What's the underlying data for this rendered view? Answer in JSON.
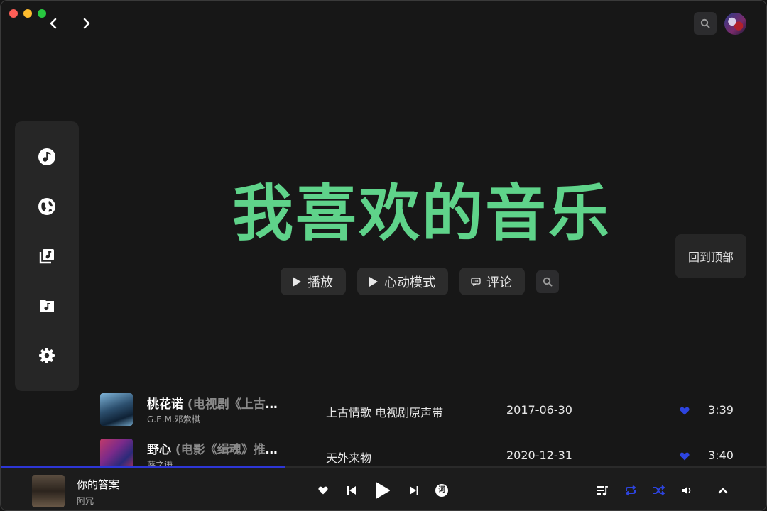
{
  "window": {
    "controls": [
      "close",
      "minimize",
      "maximize"
    ],
    "colors": {
      "close": "#ff5f57",
      "minimize": "#febc2e",
      "maximize": "#28c840"
    }
  },
  "header": {
    "back_icon": "chevron-left-icon",
    "forward_icon": "chevron-right-icon",
    "search_icon": "search-icon",
    "avatar": "user-avatar"
  },
  "sidebar": {
    "items": [
      {
        "name": "music-note-icon"
      },
      {
        "name": "explore-globe-icon"
      },
      {
        "name": "library-icon"
      },
      {
        "name": "music-folder-icon"
      },
      {
        "name": "settings-gear-icon"
      }
    ]
  },
  "page": {
    "title": "我喜欢的音乐",
    "accent": "#5fd38a",
    "actions": {
      "play": "播放",
      "heartbeat": "心动模式",
      "comments": "评论"
    },
    "back_to_top": "回到顶部"
  },
  "songs": [
    {
      "title": "桃花诺",
      "subtitle": "(电视剧《上古情歌》插曲)",
      "artist": "G.E.M.邓紫棋",
      "album": "上古情歌 电视剧原声带",
      "date": "2017-06-30",
      "duration": "3:39",
      "liked": true
    },
    {
      "title": "野心",
      "subtitle": "(电影《缉魂》推广曲)",
      "artist": "薛之谦",
      "album": "天外来物",
      "date": "2020-12-31",
      "duration": "3:40",
      "liked": true
    }
  ],
  "player": {
    "title": "你的答案",
    "artist": "阿冗",
    "progress": 0.37,
    "accent": "#2d36d6",
    "lyrics_label": "词"
  }
}
